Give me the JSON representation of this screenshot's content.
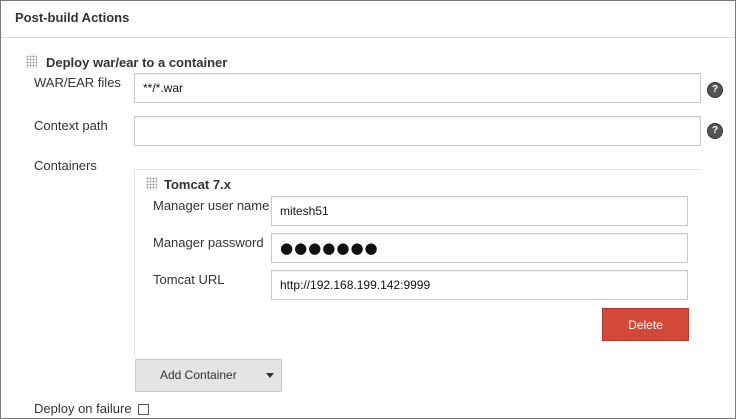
{
  "section": {
    "title": "Post-build Actions"
  },
  "deploy": {
    "title": "Deploy war/ear to a container",
    "war_files": {
      "label": "WAR/EAR files",
      "value": "**/*.war"
    },
    "context_path": {
      "label": "Context path",
      "value": ""
    },
    "containers_label": "Containers"
  },
  "tomcat": {
    "title": "Tomcat 7.x",
    "username": {
      "label": "Manager user name",
      "value": "mitesh51"
    },
    "password": {
      "label": "Manager password",
      "value": "●●●●●●●"
    },
    "url": {
      "label": "Tomcat URL",
      "value": "http://192.168.199.142:9999"
    },
    "delete_label": "Delete"
  },
  "add_container": {
    "label": "Add Container"
  },
  "deploy_on_failure": {
    "label": "Deploy on failure",
    "checked": false
  },
  "help_glyph": "?",
  "colors": {
    "delete": "#d24939",
    "add_button": "#e4e4e4",
    "border": "#7a7a7a"
  }
}
